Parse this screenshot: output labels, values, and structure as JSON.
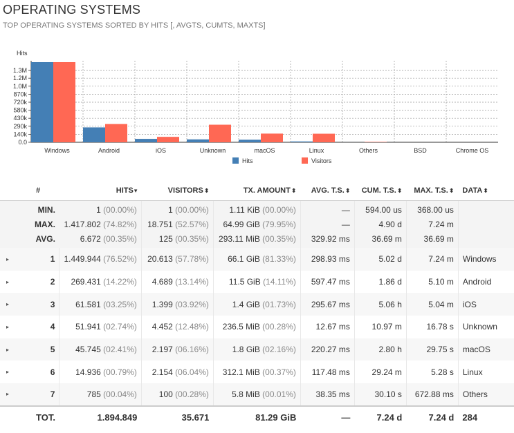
{
  "panel": {
    "title": "OPERATING SYSTEMS",
    "subtitle": "TOP OPERATING SYSTEMS SORTED BY HITS [, AVGTS, CUMTS, MAXTS]"
  },
  "colors": {
    "hits": "#447fb5",
    "visitors": "#ff6854",
    "grid": "#999999"
  },
  "chart_data": {
    "type": "bar",
    "ylabel": "Hits",
    "categories": [
      "Windows",
      "Android",
      "iOS",
      "Unknown",
      "macOS",
      "Linux",
      "Others",
      "BSD",
      "Chrome OS"
    ],
    "series": [
      {
        "name": "Hits",
        "values": [
          1449944,
          269431,
          61581,
          51941,
          45745,
          14936,
          785,
          0,
          0
        ]
      },
      {
        "name": "Visitors",
        "values": [
          1449944,
          330000,
          98000,
          318000,
          157000,
          155000,
          7000,
          0,
          0
        ]
      }
    ],
    "yticks": [
      "1.3M",
      "1.2M",
      "1.0M",
      "870k",
      "720k",
      "580k",
      "430k",
      "290k",
      "140k",
      "0.0"
    ],
    "ytick_values": [
      1300000,
      1160000,
      1015000,
      870000,
      725000,
      580000,
      435000,
      290000,
      145000,
      0
    ],
    "ylim": [
      0,
      1449944
    ],
    "legend_position": "bottom-center"
  },
  "table": {
    "headers": {
      "num": "#",
      "hits": "HITS",
      "visitors": "VISITORS",
      "tx": "TX. AMOUNT",
      "avgts": "AVG. T.S.",
      "cumts": "CUM. T.S.",
      "maxts": "MAX. T.S.",
      "data": "DATA"
    },
    "sort_icons": {
      "active": "▾",
      "inactive": "⬍"
    },
    "summary": [
      {
        "label": "MIN.",
        "hits": "1",
        "hits_pct": "(00.00%)",
        "visitors": "1",
        "visitors_pct": "(00.00%)",
        "tx": "1.11 KiB",
        "tx_pct": "(00.00%)",
        "avgts": "—",
        "cumts": "594.00 us",
        "maxts": "368.00 us"
      },
      {
        "label": "MAX.",
        "hits": "1.417.802",
        "hits_pct": "(74.82%)",
        "visitors": "18.751",
        "visitors_pct": "(52.57%)",
        "tx": "64.99 GiB",
        "tx_pct": "(79.95%)",
        "avgts": "—",
        "cumts": "4.90 d",
        "maxts": "7.24 m"
      },
      {
        "label": "AVG.",
        "hits": "6.672",
        "hits_pct": "(00.35%)",
        "visitors": "125",
        "visitors_pct": "(00.35%)",
        "tx": "293.11 MiB",
        "tx_pct": "(00.35%)",
        "avgts": "329.92 ms",
        "cumts": "36.69 m",
        "maxts": "36.69 m"
      }
    ],
    "rows": [
      {
        "expand": "▸",
        "num": "1",
        "hits": "1.449.944",
        "hits_pct": "(76.52%)",
        "visitors": "20.613",
        "visitors_pct": "(57.78%)",
        "tx": "66.1 GiB",
        "tx_pct": "(81.33%)",
        "avgts": "298.93 ms",
        "cumts": "5.02 d",
        "maxts": "7.24 m",
        "data": "Windows"
      },
      {
        "expand": "▸",
        "num": "2",
        "hits": "269.431",
        "hits_pct": "(14.22%)",
        "visitors": "4.689",
        "visitors_pct": "(13.14%)",
        "tx": "11.5 GiB",
        "tx_pct": "(14.11%)",
        "avgts": "597.47 ms",
        "cumts": "1.86 d",
        "maxts": "5.10 m",
        "data": "Android"
      },
      {
        "expand": "▸",
        "num": "3",
        "hits": "61.581",
        "hits_pct": "(03.25%)",
        "visitors": "1.399",
        "visitors_pct": "(03.92%)",
        "tx": "1.4 GiB",
        "tx_pct": "(01.73%)",
        "avgts": "295.67 ms",
        "cumts": "5.06 h",
        "maxts": "5.04 m",
        "data": "iOS"
      },
      {
        "expand": "▸",
        "num": "4",
        "hits": "51.941",
        "hits_pct": "(02.74%)",
        "visitors": "4.452",
        "visitors_pct": "(12.48%)",
        "tx": "236.5 MiB",
        "tx_pct": "(00.28%)",
        "avgts": "12.67 ms",
        "cumts": "10.97 m",
        "maxts": "16.78 s",
        "data": "Unknown"
      },
      {
        "expand": "▸",
        "num": "5",
        "hits": "45.745",
        "hits_pct": "(02.41%)",
        "visitors": "2.197",
        "visitors_pct": "(06.16%)",
        "tx": "1.8 GiB",
        "tx_pct": "(02.16%)",
        "avgts": "220.27 ms",
        "cumts": "2.80 h",
        "maxts": "29.75 s",
        "data": "macOS"
      },
      {
        "expand": "▸",
        "num": "6",
        "hits": "14.936",
        "hits_pct": "(00.79%)",
        "visitors": "2.154",
        "visitors_pct": "(06.04%)",
        "tx": "312.1 MiB",
        "tx_pct": "(00.37%)",
        "avgts": "117.48 ms",
        "cumts": "29.24 m",
        "maxts": "5.28 s",
        "data": "Linux"
      },
      {
        "expand": "▸",
        "num": "7",
        "hits": "785",
        "hits_pct": "(00.04%)",
        "visitors": "100",
        "visitors_pct": "(00.28%)",
        "tx": "5.8 MiB",
        "tx_pct": "(00.01%)",
        "avgts": "38.35 ms",
        "cumts": "30.10 s",
        "maxts": "672.88 ms",
        "data": "Others"
      }
    ],
    "total": {
      "label": "TOT.",
      "hits": "1.894.849",
      "visitors": "35.671",
      "tx": "81.29 GiB",
      "avgts": "—",
      "cumts": "7.24 d",
      "maxts": "7.24 d",
      "data": "284"
    }
  }
}
